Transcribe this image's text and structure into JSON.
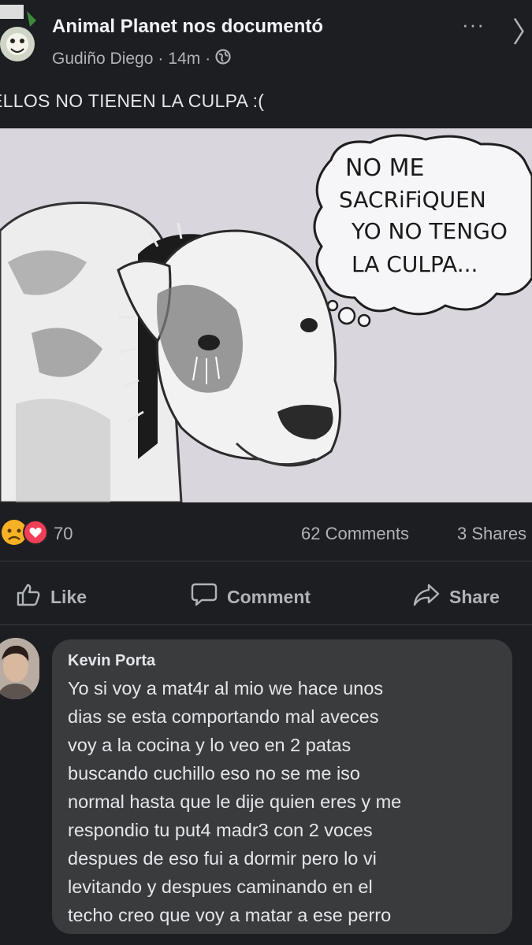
{
  "header": {
    "group_name": "Animal Planet nos documentó",
    "author": "Gudiño Diego",
    "time": "14m",
    "dot": "·",
    "more": "···",
    "close": "〉"
  },
  "post": {
    "caption": "ELLOS NO TIENEN LA CULPA :(",
    "image": {
      "speech_lines": [
        "NO ME",
        "SACRiFiQUEN",
        "YO NO TENGO",
        "LA CULPA..."
      ]
    }
  },
  "stats": {
    "reaction_count": "70",
    "comments": "62 Comments",
    "shares": "3 Shares"
  },
  "actions": {
    "like": "Like",
    "comment": "Comment",
    "share": "Share"
  },
  "comment": {
    "name": "Kevin Porta",
    "lines": [
      "Yo si voy a mat4r al mio we hace unos",
      "dias se esta comportando mal aveces",
      "voy a la cocina y lo veo en 2 patas",
      "buscando cuchillo eso no se me iso",
      "normal hasta que le dije quien eres y me",
      "respondio tu put4 madr3 con 2 voces",
      "despues de eso fui a dormir pero lo vi",
      "levitando y despues caminando en el",
      "techo creo que voy a matar a ese perro"
    ]
  },
  "colors": {
    "background": "#1c1e21",
    "bubble": "#3a3b3c",
    "text": "#e4e6eb",
    "muted": "#b0b3b8",
    "love": "#f33e58",
    "sad": "#f7b125"
  }
}
